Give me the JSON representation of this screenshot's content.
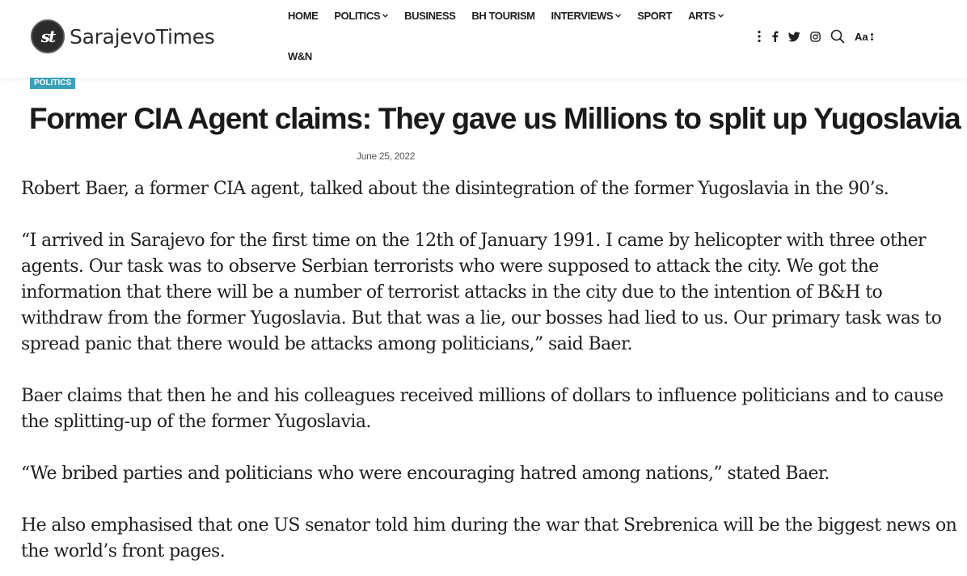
{
  "header": {
    "logo_mark": "st",
    "logo_text": "SarajevoTimes",
    "nav": [
      {
        "label": "HOME",
        "dropdown": false
      },
      {
        "label": "POLITICS",
        "dropdown": true
      },
      {
        "label": "BUSINESS",
        "dropdown": false
      },
      {
        "label": "BH TOURISM",
        "dropdown": false
      },
      {
        "label": "INTERVIEWS",
        "dropdown": true
      },
      {
        "label": "SPORT",
        "dropdown": false
      },
      {
        "label": "ARTS",
        "dropdown": true
      },
      {
        "label": "W&N",
        "dropdown": false
      }
    ],
    "tools": {
      "more": "more-vertical-icon",
      "facebook": "facebook-icon",
      "twitter": "twitter-icon",
      "instagram": "instagram-icon",
      "search": "search-icon",
      "font_size_label": "Aa"
    }
  },
  "article": {
    "category": "POLITICS",
    "category_color": "#3aa1b8",
    "title": "Former CIA Agent claims: They gave us Millions to split up  Yugoslavia",
    "date": "June 25, 2022",
    "paragraphs": [
      "Robert Baer, a former CIA agent, talked about the disintegration of the former Yugoslavia in the 90’s.",
      "“I arrived in Sarajevo for the first time on the 12th of January 1991. I came by helicopter with three other agents. Our task was to observe Serbian terrorists who were supposed to attack the city. We got the information that there will be a number of terrorist attacks in the city due to the intention of B&H to withdraw from the former Yugoslavia. But that was a lie, our bosses had lied to us. Our primary task was to spread panic that there would be attacks among politicians,” said Baer.",
      "Baer claims that then he and his colleagues received millions of dollars to influence politicians and to cause the splitting-up of the former Yugoslavia.",
      "“We bribed parties and politicians who were encouraging hatred among nations,” stated Baer.",
      "He also emphasised that one US senator told him during the war that Srebrenica will be the biggest news on the world’s front pages."
    ]
  }
}
